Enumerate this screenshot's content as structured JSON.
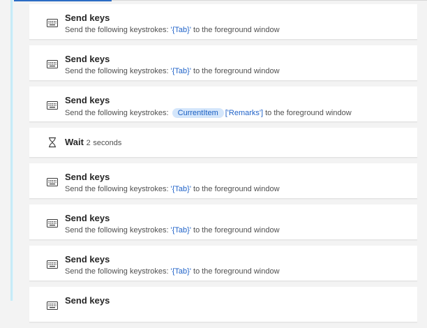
{
  "actions": [
    {
      "type": "send-keys",
      "title": "Send keys",
      "prefix": "Send the following keystrokes:",
      "keys": "'{Tab}'",
      "suffix": "to the foreground window"
    },
    {
      "type": "send-keys",
      "title": "Send keys",
      "prefix": "Send the following keystrokes:",
      "keys": "'{Tab}'",
      "suffix": "to the foreground window"
    },
    {
      "type": "send-keys-var",
      "title": "Send keys",
      "prefix": "Send the following keystrokes:",
      "variable": "CurrentItem",
      "property": "['Remarks']",
      "suffix": "to the foreground window"
    },
    {
      "type": "wait",
      "title": "Wait",
      "value": "2",
      "unit": "seconds"
    },
    {
      "type": "send-keys",
      "title": "Send keys",
      "prefix": "Send the following keystrokes:",
      "keys": "'{Tab}'",
      "suffix": "to the foreground window"
    },
    {
      "type": "send-keys",
      "title": "Send keys",
      "prefix": "Send the following keystrokes:",
      "keys": "'{Tab}'",
      "suffix": "to the foreground window"
    },
    {
      "type": "send-keys",
      "title": "Send keys",
      "prefix": "Send the following keystrokes:",
      "keys": "'{Tab}'",
      "suffix": "to the foreground window"
    },
    {
      "type": "send-keys",
      "title": "Send keys",
      "prefix": "",
      "keys": "",
      "suffix": ""
    }
  ],
  "icons": {
    "send_keys": "keyboard-icon",
    "wait": "hourglass-icon"
  },
  "colors": {
    "accent": "#2b6cc4",
    "value_text": "#1f62c8",
    "variable_pill": "#d4e6fb",
    "guide_line": "#c7ebf7"
  }
}
